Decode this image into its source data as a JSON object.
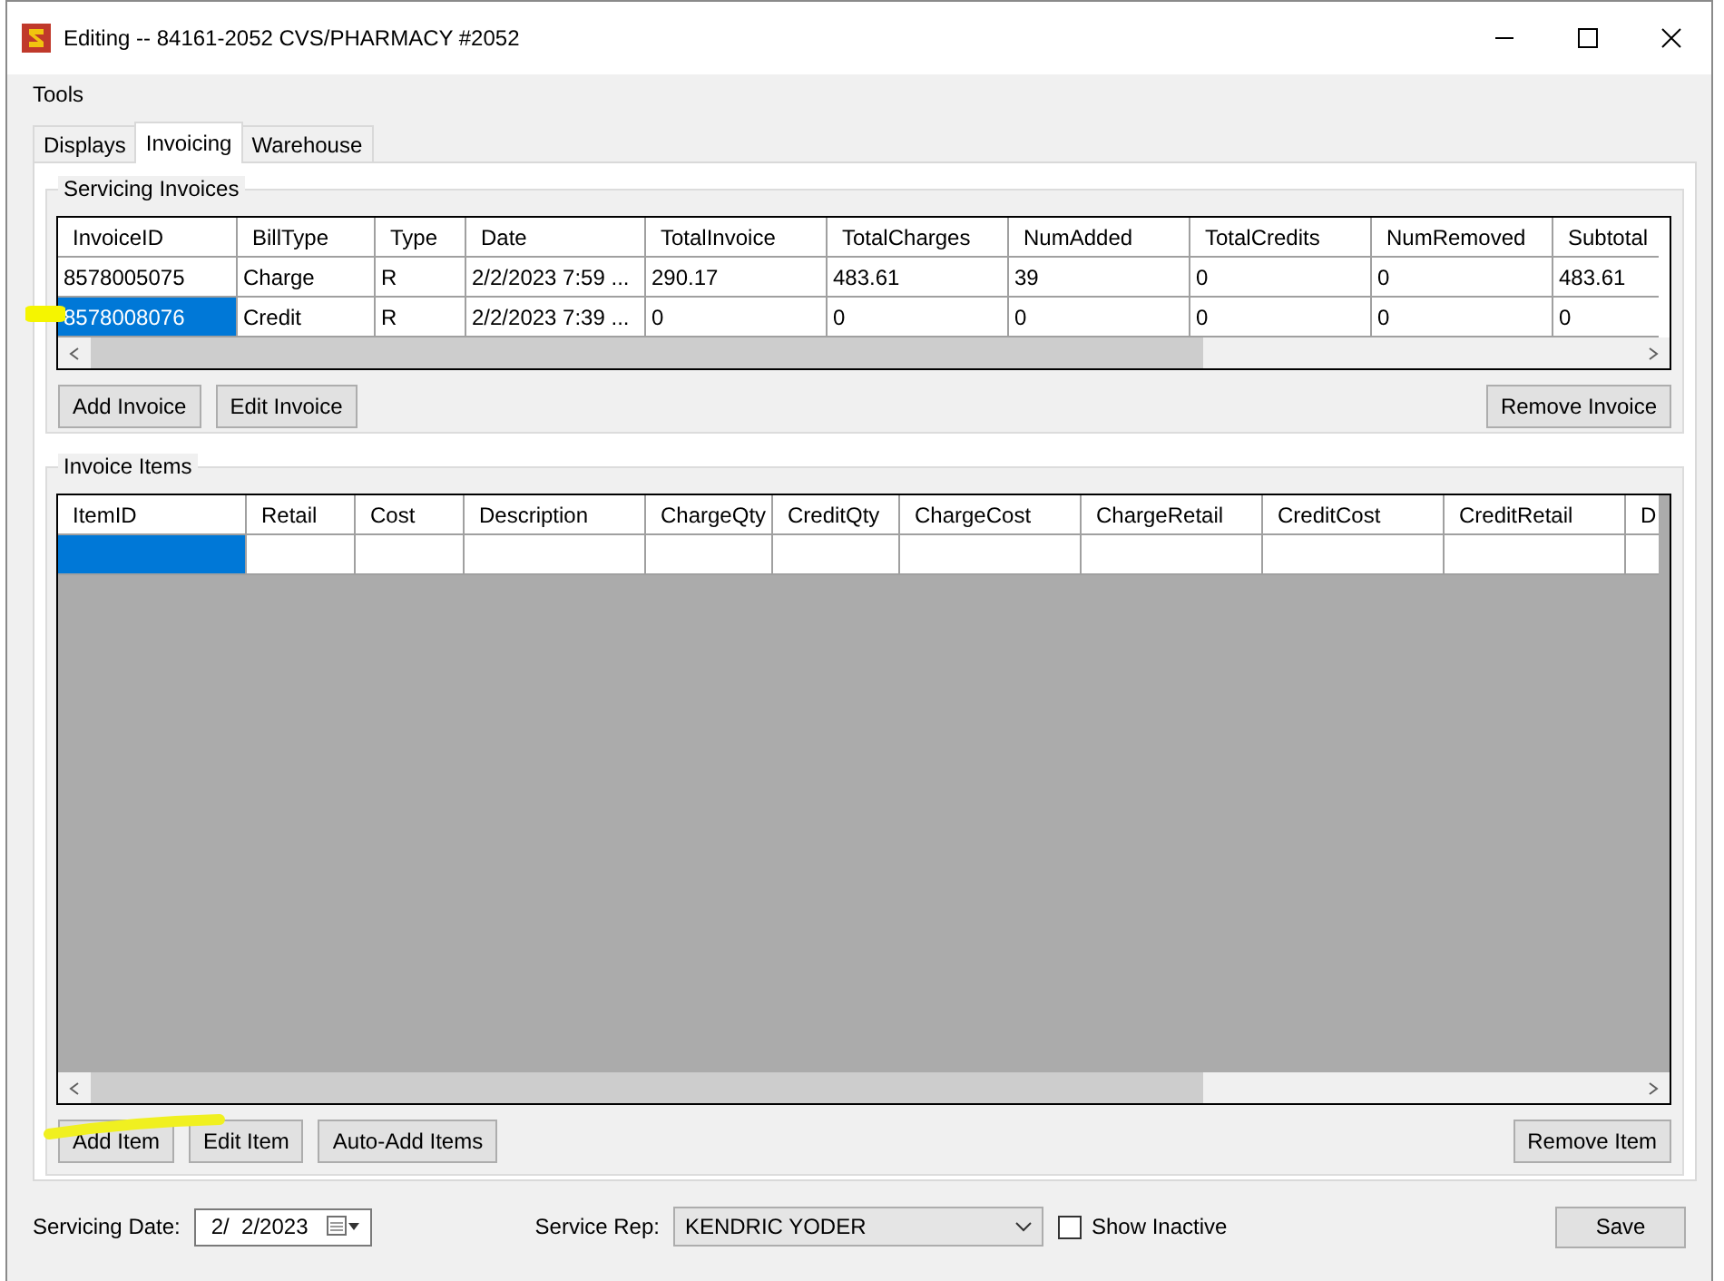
{
  "window": {
    "title": "Editing -- 84161-2052 CVS/PHARMACY #2052"
  },
  "menu": [
    "Tools"
  ],
  "tabs": [
    {
      "label": "Displays",
      "selected": false
    },
    {
      "label": "Invoicing",
      "selected": true
    },
    {
      "label": "Warehouse",
      "selected": false
    }
  ],
  "invoices": {
    "title": "Servicing Invoices",
    "columns": [
      "InvoiceID",
      "BillType",
      "Type",
      "Date",
      "TotalInvoice",
      "TotalCharges",
      "NumAdded",
      "TotalCredits",
      "NumRemoved",
      "Subtotal"
    ],
    "rows": [
      {
        "selected": false,
        "cells": [
          "8578005075",
          "Charge",
          "R",
          "2/2/2023 7:59 ...",
          "290.17",
          "483.61",
          "39",
          "0",
          "0",
          "483.61"
        ]
      },
      {
        "selected": true,
        "cells": [
          "8578008076",
          "Credit",
          "R",
          "2/2/2023 7:39 ...",
          "0",
          "0",
          "0",
          "0",
          "0",
          "0"
        ]
      }
    ],
    "buttons": [
      "Add Invoice",
      "Edit Invoice"
    ],
    "right_button": "Remove Invoice"
  },
  "items": {
    "title": "Invoice Items",
    "columns": [
      "ItemID",
      "Retail",
      "Cost",
      "Description",
      "ChargeQty",
      "CreditQty",
      "ChargeCost",
      "ChargeRetail",
      "CreditCost",
      "CreditRetail",
      "D"
    ],
    "rows": [
      {
        "selected": true,
        "cells": [
          "",
          "",
          "",
          "",
          "",
          "",
          "",
          "",
          "",
          "",
          ""
        ]
      }
    ],
    "buttons": [
      "Add Item",
      "Edit Item",
      "Auto-Add Items"
    ],
    "right_button": "Remove Item"
  },
  "footer": {
    "date_label": "Servicing Date:",
    "date_value": "2/  2/2023",
    "rep_label": "Service Rep:",
    "rep_value": "KENDRIC YODER",
    "show_inactive": {
      "label": "Show Inactive",
      "checked": false
    },
    "save": "Save"
  }
}
